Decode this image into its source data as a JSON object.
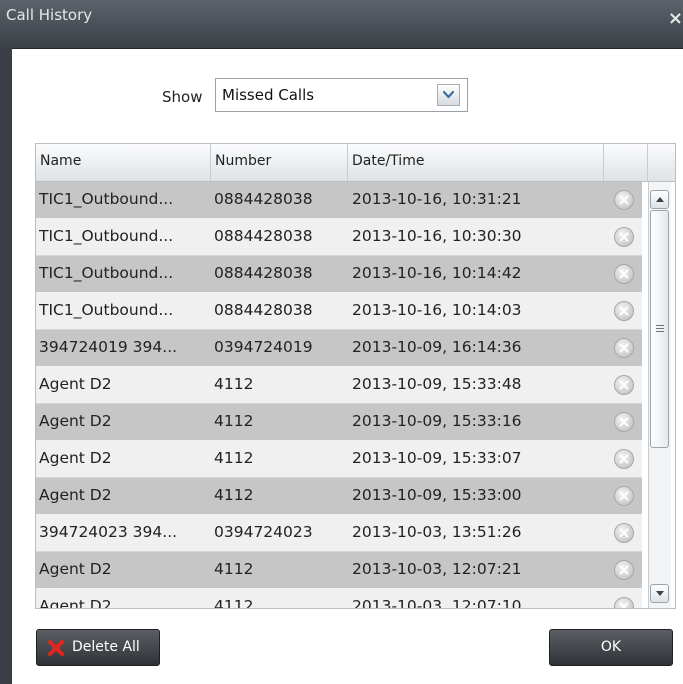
{
  "window": {
    "title": "Call History",
    "close_symbol": "×"
  },
  "filter": {
    "label": "Show",
    "selected": "Missed Calls"
  },
  "table": {
    "columns": [
      "Name",
      "Number",
      "Date/Time"
    ],
    "rows": [
      {
        "name": "TIC1_Outbound...",
        "number": "0884428038",
        "datetime": "2013-10-16, 10:31:21"
      },
      {
        "name": "TIC1_Outbound...",
        "number": "0884428038",
        "datetime": "2013-10-16, 10:30:30"
      },
      {
        "name": "TIC1_Outbound...",
        "number": "0884428038",
        "datetime": "2013-10-16, 10:14:42"
      },
      {
        "name": "TIC1_Outbound...",
        "number": "0884428038",
        "datetime": "2013-10-16, 10:14:03"
      },
      {
        "name": "394724019 394...",
        "number": "0394724019",
        "datetime": "2013-10-09, 16:14:36"
      },
      {
        "name": "Agent D2",
        "number": "4112",
        "datetime": "2013-10-09, 15:33:48"
      },
      {
        "name": "Agent D2",
        "number": "4112",
        "datetime": "2013-10-09, 15:33:16"
      },
      {
        "name": "Agent D2",
        "number": "4112",
        "datetime": "2013-10-09, 15:33:07"
      },
      {
        "name": "Agent D2",
        "number": "4112",
        "datetime": "2013-10-09, 15:33:00"
      },
      {
        "name": "394724023 394...",
        "number": "0394724023",
        "datetime": "2013-10-03, 13:51:26"
      },
      {
        "name": "Agent D2",
        "number": "4112",
        "datetime": "2013-10-03, 12:07:21"
      },
      {
        "name": "Agent D2",
        "number": "4112",
        "datetime": "2013-10-03, 12:07:10"
      }
    ]
  },
  "buttons": {
    "delete_all": "Delete All",
    "ok": "OK"
  },
  "colors": {
    "title_bar": "#4a5058",
    "row_dark": "#c6c6c6",
    "row_light": "#f0f0f0",
    "delete_icon": "#d8261f",
    "button": "#3c4045"
  },
  "icons": {
    "row_delete": "circle-x-icon",
    "delete_all": "red-x-icon",
    "dropdown": "chevron-down-icon"
  }
}
